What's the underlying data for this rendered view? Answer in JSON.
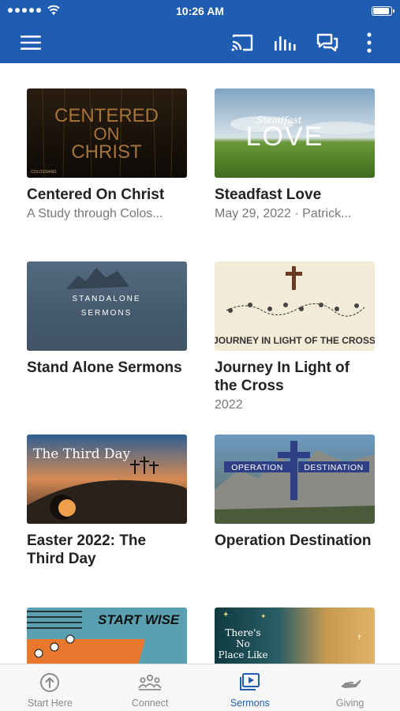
{
  "status_bar": {
    "time": "10:26 AM"
  },
  "nav": {
    "icons": [
      "menu-icon",
      "cast-icon",
      "audio-bars-icon",
      "chat-icon",
      "more-vertical-icon"
    ],
    "color": "#1e5db2"
  },
  "cards": [
    {
      "title": "Centered On Christ",
      "subtitle": "A Study through Colos...",
      "art": {
        "line1": "CENTERED",
        "line2": "ON",
        "line3": "CHRIST",
        "tag": "COLOSSIANS"
      }
    },
    {
      "title": "Steadfast Love",
      "subtitle": "May 29, 2022 · Patrick...",
      "art": {
        "script": "Steadfast",
        "big": "LOVE"
      }
    },
    {
      "title": "Stand Alone Sermons",
      "subtitle": "",
      "art": {
        "line1": "STANDALONE",
        "line2": "SERMONS"
      }
    },
    {
      "title": "Journey In Light of the Cross",
      "subtitle": "2022",
      "art": {
        "banner": "JOURNEY IN LIGHT OF THE CROSS"
      }
    },
    {
      "title": "Easter 2022: The Third Day",
      "subtitle": "",
      "art": {
        "script": "The Third Day"
      }
    },
    {
      "title": "Operation Destination",
      "subtitle": "",
      "art": {
        "left": "OPERATION",
        "right": "DESTINATION"
      }
    },
    {
      "title": "",
      "subtitle": "",
      "art": {
        "banner": "START WISE"
      }
    },
    {
      "title": "",
      "subtitle": "",
      "art": {
        "line1": "There's",
        "line2": "No",
        "line3": "Place Like"
      }
    }
  ],
  "tabs": [
    {
      "label": "Start Here",
      "icon": "arrow-up-circle-icon",
      "active": false
    },
    {
      "label": "Connect",
      "icon": "people-icon",
      "active": false
    },
    {
      "label": "Sermons",
      "icon": "play-video-icon",
      "active": true
    },
    {
      "label": "Giving",
      "icon": "giving-hand-icon",
      "active": false
    }
  ]
}
